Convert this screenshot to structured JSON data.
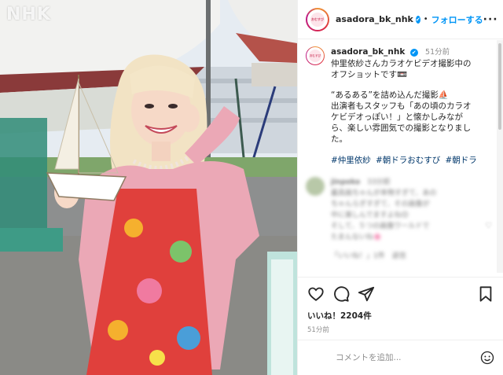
{
  "photo": {
    "watermark": "NHK"
  },
  "header": {
    "username": "asadora_bk_nhk",
    "verified": "✔",
    "separator": "•",
    "follow_label": "フォローする",
    "more_label": "···",
    "avatar_text": "おむすび"
  },
  "caption": {
    "username": "asadora_bk_nhk",
    "time": "51分前",
    "lines": [
      "仲里依紗さんカラオケビデオ撮影中の",
      "オフショットです📼",
      "",
      "“あるある”を詰め込んだ撮影⛵",
      "出演者もスタッフも「あの頃のカラオ",
      "ケビデオっぽい！」と懐かしみなが",
      "ら、楽しい雰囲気での撮影となりまし",
      "た。"
    ],
    "hashtags": [
      "#仲里依紗",
      "#朝ドラおむすび",
      "#朝ドラ"
    ]
  },
  "blurred_comment": {
    "name": "jinpoko",
    "time": "33分前",
    "lines": [
      "最高画ちゃんが本物すぎて、あの",
      "ちゃんらぎすぎて、その画像が",
      "中に楽しんでますよね😊",
      "そして、５つの画像ワールドで",
      "たまんないね🌸"
    ],
    "reply_label": "「いいね！」1件　返信"
  },
  "actions": {
    "icons": [
      "heart-icon",
      "comment-icon",
      "share-icon",
      "bookmark-icon"
    ],
    "likes": "いいね！2204件",
    "posted": "51分前"
  },
  "comment_input": {
    "placeholder": "コメントを追加...",
    "emoji_icon": "smiley-icon"
  },
  "colors": {
    "accent": "#0095f6",
    "hashtag": "#00376b",
    "muted": "#8e8e8e"
  }
}
